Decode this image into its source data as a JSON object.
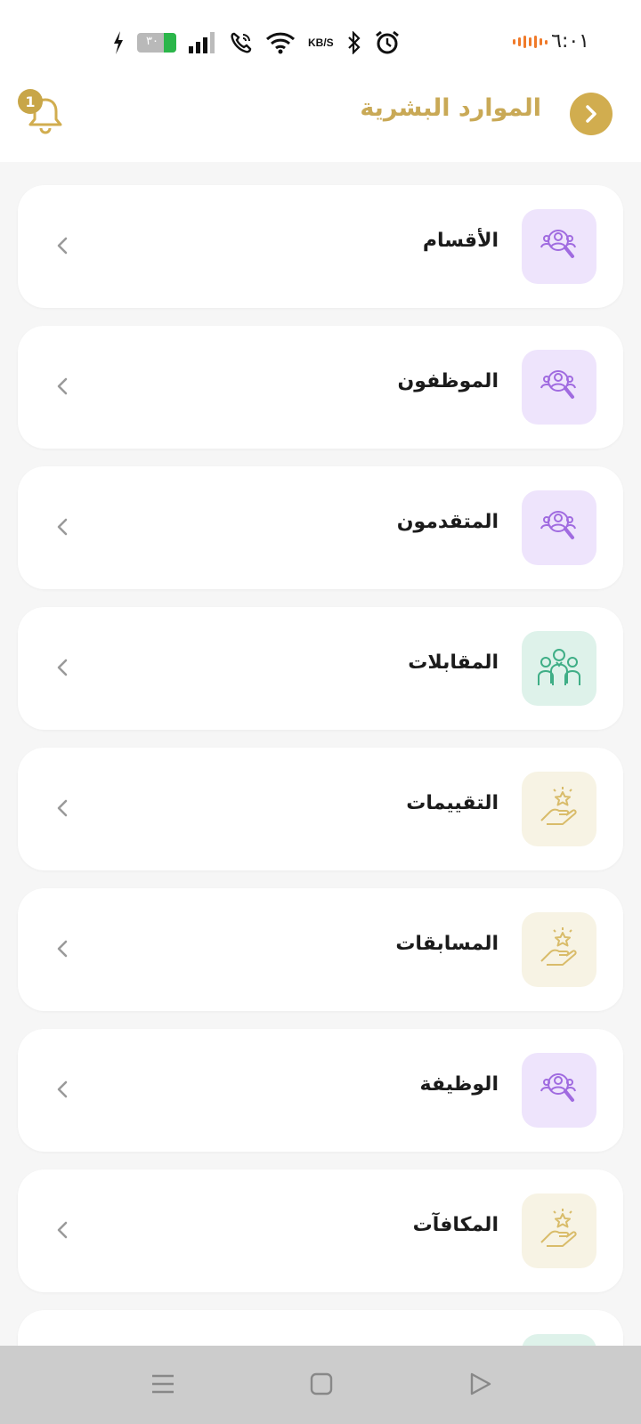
{
  "status_bar": {
    "time": "٦:٠١",
    "battery_percent": "٣٠",
    "network_speed_unit": "KB/S"
  },
  "header": {
    "title": "الموارد البشرية",
    "notification_count": "1"
  },
  "menu_items": [
    {
      "label": "الأقسام",
      "icon": "people-search-icon",
      "tone": "purple"
    },
    {
      "label": "الموظفون",
      "icon": "people-search-icon",
      "tone": "purple"
    },
    {
      "label": "المتقدمون",
      "icon": "people-search-icon",
      "tone": "purple"
    },
    {
      "label": "المقابلات",
      "icon": "group-meeting-icon",
      "tone": "green"
    },
    {
      "label": "التقييمات",
      "icon": "hand-star-icon",
      "tone": "gold"
    },
    {
      "label": "المسابقات",
      "icon": "hand-star-icon",
      "tone": "gold"
    },
    {
      "label": "الوظيفة",
      "icon": "people-search-icon",
      "tone": "purple"
    },
    {
      "label": "المكافآت",
      "icon": "hand-star-icon",
      "tone": "gold"
    }
  ],
  "colors": {
    "accent_gold": "#c9a956",
    "purple_tile": "#eee4fc",
    "purple_icon": "#a06be0",
    "green_tile": "#def2ea",
    "green_icon": "#3fae86",
    "gold_tile": "#f7f3e4",
    "gold_icon": "#d9bc6a"
  },
  "nav_bar": {
    "items": [
      "menu-icon",
      "home-square-icon",
      "back-triangle-icon"
    ]
  }
}
